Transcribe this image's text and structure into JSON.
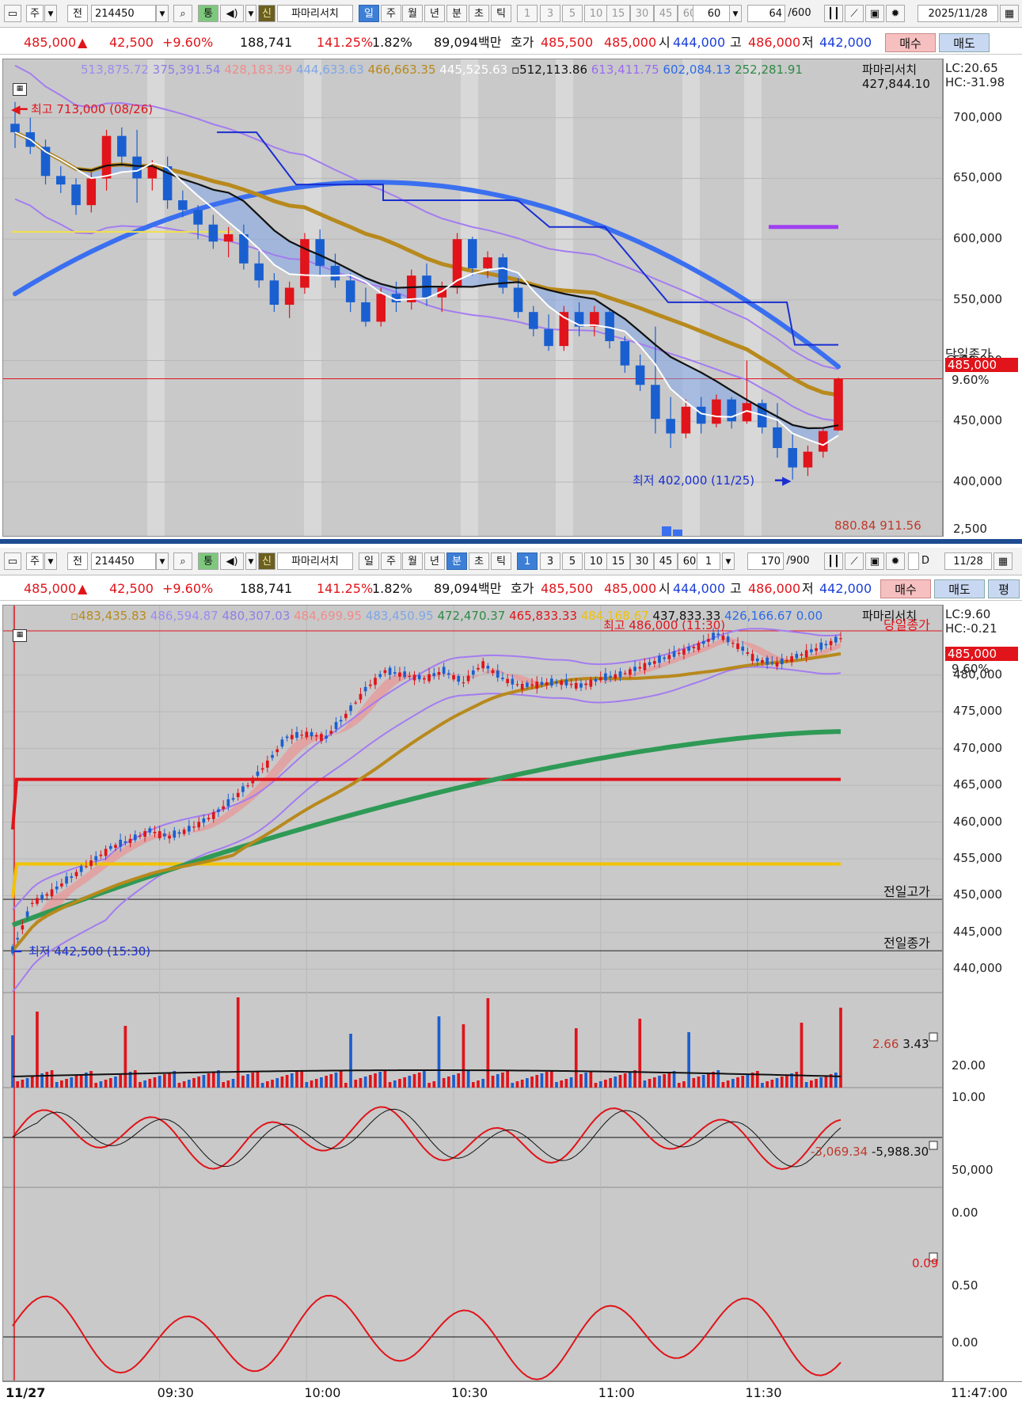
{
  "toolbar_top": {
    "period_unit": "주",
    "jeon": "전",
    "code": "214450",
    "tong": "통",
    "sin": "신",
    "search_name": "파마리서치",
    "period_buttons": [
      "일",
      "주",
      "월",
      "년",
      "분",
      "초",
      "틱"
    ],
    "period_active": "일",
    "intervals": [
      "1",
      "3",
      "5",
      "10",
      "15",
      "30",
      "45",
      "60"
    ],
    "interval_select": "60",
    "count": "64",
    "count_max": "/600",
    "date": "2025/11/28"
  },
  "quote": {
    "price": "485,000",
    "change": "42,500",
    "change_pct": "+9.60%",
    "volume": "188,741",
    "vol_ratio": "141.25%",
    "turnover": "1.82%",
    "amount": "89,094백만",
    "ask_label": "호가",
    "ask1": "485,500",
    "ask2": "485,000",
    "open_label": "시",
    "open": "444,000",
    "high_label": "고",
    "high": "486,000",
    "low_label": "저",
    "low": "442,000",
    "buy": "매수",
    "sell": "매도",
    "pyeong": "평"
  },
  "toolbar_bottom": {
    "period_unit": "주",
    "jeon": "전",
    "code": "214450",
    "tong": "통",
    "sin": "신",
    "search_name": "파마리서치",
    "period_buttons": [
      "일",
      "주",
      "월",
      "년",
      "분",
      "초",
      "틱"
    ],
    "period_active": "분",
    "intervals": [
      "1",
      "3",
      "5",
      "10",
      "15",
      "30",
      "45",
      "60"
    ],
    "interval_active": "1",
    "interval_select": "1",
    "count": "170",
    "count_max": "/900",
    "d_label": "D",
    "date": "11/28"
  },
  "chart_data": [
    {
      "type": "candlestick",
      "name": "daily",
      "legend": [
        "513,875.72",
        "375,391.54",
        "428,183.39",
        "444,633.63",
        "466,663.35",
        "445,525.63",
        "512,113.86",
        "613,411.75",
        "602,084.13",
        "252,281.91",
        "427,844.10"
      ],
      "legend_colors": [
        "#9b8cf0",
        "#8d7fe8",
        "#f08c8c",
        "#7fa6e8",
        "#b8891c",
        "#ffffff",
        "#111111",
        "#9b6cf0",
        "#2b6be8",
        "#2e8a46",
        "#111111"
      ],
      "stock_name": "파마리서치",
      "lc_label": "LC:20.65",
      "hc_label": "HC:-31.98",
      "ylim": [
        370000,
        735000
      ],
      "yticks": [
        700000,
        650000,
        600000,
        550000,
        500000,
        450000,
        400000
      ],
      "ytick_labels": [
        "700,000",
        "650,000",
        "600,000",
        "550,000",
        "500,000",
        "450,000",
        "400,000"
      ],
      "close_line": 485000,
      "close_label": "당일종가",
      "close_tag": "485,000",
      "close_pct": "9.60%",
      "high_annotation": "최고 713,000 (08/26)",
      "low_annotation": "최저 402,000 (11/25)",
      "bottom_values": "880.84 911.56",
      "bottom_axis_label": "2,500",
      "ohlc": [
        [
          695000,
          713000,
          675000,
          688000
        ],
        [
          688000,
          700000,
          670000,
          676000
        ],
        [
          676000,
          682000,
          645000,
          652000
        ],
        [
          652000,
          660000,
          638000,
          645000
        ],
        [
          645000,
          650000,
          620000,
          628000
        ],
        [
          628000,
          655000,
          622000,
          650000
        ],
        [
          650000,
          690000,
          640000,
          685000
        ],
        [
          685000,
          692000,
          660000,
          668000
        ],
        [
          668000,
          690000,
          630000,
          650000
        ],
        [
          650000,
          665000,
          640000,
          660000
        ],
        [
          660000,
          668000,
          625000,
          632000
        ],
        [
          632000,
          640000,
          618000,
          624000
        ],
        [
          624000,
          628000,
          600000,
          612000
        ],
        [
          612000,
          620000,
          592000,
          598000
        ],
        [
          598000,
          610000,
          585000,
          604000
        ],
        [
          604000,
          612000,
          575000,
          580000
        ],
        [
          580000,
          590000,
          560000,
          566000
        ],
        [
          566000,
          572000,
          540000,
          546000
        ],
        [
          546000,
          565000,
          535000,
          560000
        ],
        [
          560000,
          605000,
          555000,
          600000
        ],
        [
          600000,
          608000,
          570000,
          578000
        ],
        [
          578000,
          588000,
          560000,
          566000
        ],
        [
          566000,
          572000,
          540000,
          548000
        ],
        [
          548000,
          560000,
          528000,
          532000
        ],
        [
          532000,
          560000,
          528000,
          555000
        ],
        [
          555000,
          565000,
          540000,
          548000
        ],
        [
          548000,
          575000,
          542000,
          570000
        ],
        [
          570000,
          580000,
          545000,
          552000
        ],
        [
          552000,
          565000,
          540000,
          560000
        ],
        [
          560000,
          605000,
          555000,
          600000
        ],
        [
          600000,
          602000,
          570000,
          576000
        ],
        [
          576000,
          590000,
          568000,
          585000
        ],
        [
          585000,
          588000,
          555000,
          560000
        ],
        [
          560000,
          568000,
          535000,
          540000
        ],
        [
          540000,
          545000,
          520000,
          526000
        ],
        [
          526000,
          538000,
          508000,
          512000
        ],
        [
          512000,
          545000,
          508000,
          540000
        ],
        [
          540000,
          548000,
          520000,
          528000
        ],
        [
          528000,
          545000,
          520000,
          540000
        ],
        [
          540000,
          542000,
          510000,
          516000
        ],
        [
          516000,
          520000,
          490000,
          496000
        ],
        [
          496000,
          505000,
          475000,
          480000
        ],
        [
          480000,
          528000,
          440000,
          452000
        ],
        [
          452000,
          470000,
          428000,
          440000
        ],
        [
          440000,
          468000,
          436000,
          462000
        ],
        [
          462000,
          470000,
          440000,
          448000
        ],
        [
          448000,
          472000,
          445000,
          468000
        ],
        [
          468000,
          470000,
          444000,
          450000
        ],
        [
          450000,
          500000,
          448000,
          465000
        ],
        [
          465000,
          468000,
          440000,
          445000
        ],
        [
          445000,
          465000,
          420000,
          428000
        ],
        [
          428000,
          440000,
          402000,
          412000
        ],
        [
          412000,
          430000,
          405000,
          425000
        ],
        [
          425000,
          445000,
          420000,
          442000
        ],
        [
          442500,
          486000,
          442000,
          485000
        ]
      ]
    },
    {
      "type": "candlestick",
      "name": "minute",
      "legend": [
        "483,435.83",
        "486,594.87",
        "480,307.03",
        "484,699.95",
        "483,450.95",
        "472,470.37",
        "465,833.33",
        "484,168.67",
        "437,833.33",
        "426,166.67",
        "0.00"
      ],
      "legend_colors": [
        "#b8891c",
        "#9b8cf0",
        "#8d7fe8",
        "#f08c8c",
        "#7fa6e8",
        "#2e8a46",
        "#e0141a",
        "#f2c200",
        "#111111",
        "#2b6be8",
        "#2b6be8"
      ],
      "stock_name": "파마리서치",
      "lc_label": "LC:9.60",
      "hc_label": "HC:-0.21",
      "ylim": [
        438000,
        487500
      ],
      "yticks": [
        480000,
        475000,
        470000,
        465000,
        460000,
        455000,
        450000,
        445000,
        440000
      ],
      "ytick_labels": [
        "480,000",
        "475,000",
        "470,000",
        "465,000",
        "460,000",
        "455,000",
        "450,000",
        "445,000",
        "440,000"
      ],
      "close_label": "당일종가",
      "close_tag": "485,000",
      "close_pct": "9.60%",
      "prev_high_label": "전일고가",
      "prev_high": 449500,
      "prev_close_label": "전일종가",
      "prev_close": 442500,
      "high_annotation": "최고 486,000 (11:30)",
      "low_annotation": "최저 442,500 (15:30)",
      "x_labels": [
        "11/27",
        "09:30",
        "10:00",
        "10:30",
        "11:00",
        "11:30",
        "11:47:00"
      ],
      "x_label_index": [
        0,
        30,
        60,
        90,
        120,
        150
      ],
      "path_points": [
        [
          0,
          442500
        ],
        [
          4,
          449000
        ],
        [
          8,
          450500
        ],
        [
          12,
          452500
        ],
        [
          16,
          454500
        ],
        [
          20,
          456500
        ],
        [
          24,
          457500
        ],
        [
          28,
          458800
        ],
        [
          32,
          458000
        ],
        [
          36,
          459000
        ],
        [
          40,
          460500
        ],
        [
          44,
          462500
        ],
        [
          48,
          465000
        ],
        [
          52,
          468000
        ],
        [
          56,
          471500
        ],
        [
          60,
          472000
        ],
        [
          64,
          471500
        ],
        [
          68,
          474500
        ],
        [
          72,
          478000
        ],
        [
          76,
          480500
        ],
        [
          80,
          480000
        ],
        [
          84,
          479500
        ],
        [
          88,
          480500
        ],
        [
          92,
          479000
        ],
        [
          96,
          481500
        ],
        [
          100,
          479500
        ],
        [
          104,
          478500
        ],
        [
          108,
          478800
        ],
        [
          112,
          479000
        ],
        [
          116,
          478500
        ],
        [
          120,
          479500
        ],
        [
          124,
          480000
        ],
        [
          128,
          481000
        ],
        [
          132,
          482000
        ],
        [
          136,
          483000
        ],
        [
          140,
          484000
        ],
        [
          144,
          485500
        ],
        [
          148,
          484000
        ],
        [
          152,
          482000
        ],
        [
          156,
          481500
        ],
        [
          160,
          482500
        ],
        [
          164,
          483500
        ],
        [
          169,
          485000
        ]
      ],
      "volume_panel": {
        "labels": [
          "2.66",
          "3.43"
        ],
        "yticks": [
          "20.00",
          "10.00"
        ]
      },
      "osc1_panel": {
        "labels": [
          "-3,069.34",
          "-5,988.30"
        ],
        "yticks": [
          "50,000",
          "0.00"
        ]
      },
      "osc2_panel": {
        "labels": [
          "0.09"
        ],
        "yticks": [
          "0.50",
          "0.00"
        ]
      }
    }
  ]
}
